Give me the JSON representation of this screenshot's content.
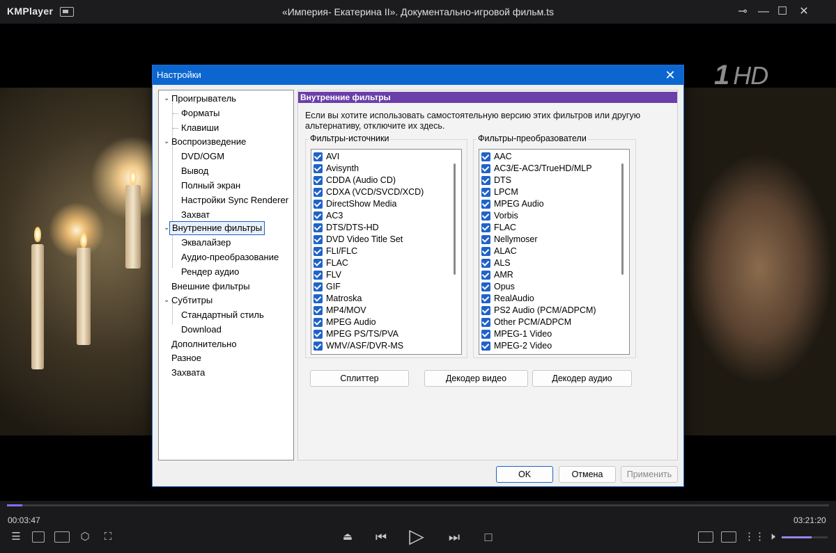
{
  "app": {
    "logo": "KMPlayer",
    "file_title": "«Империя- Екатерина II». Документально-игровой фильм.ts",
    "channel_logo": "1",
    "channel_logo_hd": "HD"
  },
  "player": {
    "time_current": "00:03:47",
    "time_total": "03:21:20",
    "progress": 0.019,
    "volume": 0.65,
    "accent_color": "#8b6cf0"
  },
  "dialog": {
    "title": "Настройки",
    "tree": [
      "Проигрыватель",
      "Форматы",
      "Клавиши",
      "Воспроизведение",
      "DVD/OGM",
      "Вывод",
      "Полный экран",
      "Настройки Sync Renderer",
      "Захват",
      "Внутренние фильтры",
      "Эквалайзер",
      "Аудио-преобразование",
      "Рендер аудио",
      "Внешние фильтры",
      "Субтитры",
      "Стандартный стиль",
      "Download",
      "Дополнительно",
      "Разное",
      "Захвата"
    ],
    "selected_item": "Внутренние фильтры",
    "panel": {
      "header": "Внутренние фильтры",
      "description": "Если вы хотите использовать самостоятельную версию этих фильтров или другую альтернативу, отключите их здесь.",
      "source_group_label": "Фильтры-источники",
      "transform_group_label": "Фильтры-преобразователи",
      "source_filters": [
        "AVI",
        "Avisynth",
        "CDDA (Audio CD)",
        "CDXA (VCD/SVCD/XCD)",
        "DirectShow Media",
        "AC3",
        "DTS/DTS-HD",
        "DVD Video Title Set",
        "FLI/FLC",
        "FLAC",
        "FLV",
        "GIF",
        "Matroska",
        "MP4/MOV",
        "MPEG Audio",
        "MPEG PS/TS/PVA",
        "WMV/ASF/DVR-MS"
      ],
      "transform_filters": [
        "AAC",
        "AC3/E-AC3/TrueHD/MLP",
        "DTS",
        "LPCM",
        "MPEG Audio",
        "Vorbis",
        "FLAC",
        "Nellymoser",
        "ALAC",
        "ALS",
        "AMR",
        "Opus",
        "RealAudio",
        "PS2 Audio (PCM/ADPCM)",
        "Other PCM/ADPCM",
        "MPEG-1 Video",
        "MPEG-2 Video"
      ],
      "splitter_button": "Сплиттер",
      "video_decoder_button": "Декодер видео",
      "audio_decoder_button": "Декодер аудио"
    },
    "ok_button": "OK",
    "cancel_button": "Отмена",
    "apply_button": "Применить"
  }
}
